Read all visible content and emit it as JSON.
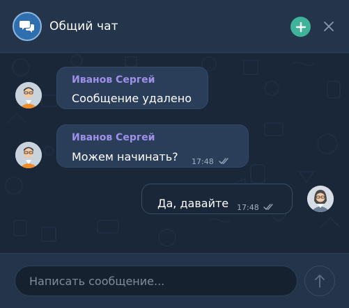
{
  "header": {
    "title": "Общий чат",
    "avatar_icon": "chat-bubbles-icon",
    "add_icon": "plus-icon",
    "close_icon": "close-icon"
  },
  "messages": [
    {
      "direction": "incoming",
      "sender": "Иванов Сергей",
      "text": "Сообщение удалено",
      "time": "",
      "avatar_icon": "user-avatar"
    },
    {
      "direction": "incoming",
      "sender": "Иванов Сергей",
      "text": "Можем начинать?",
      "time": "17:48",
      "read": true,
      "avatar_icon": "user-avatar"
    },
    {
      "direction": "outgoing",
      "sender": "",
      "text": "Да, давайте",
      "time": "17:48",
      "read": true,
      "avatar_icon": "user-avatar-female"
    }
  ],
  "composer": {
    "placeholder": "Написать сообщение...",
    "value": "",
    "send_icon": "arrow-up-icon"
  },
  "colors": {
    "accent": "#3fb29a",
    "sender_name": "#9f90ea",
    "header_bg": "#23344b",
    "chat_bg": "#1a2738",
    "bubble_bg": "#2a3e59"
  }
}
